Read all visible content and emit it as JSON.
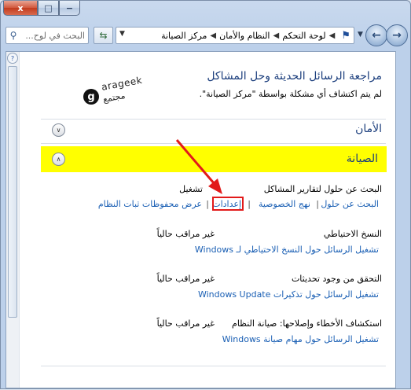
{
  "window": {
    "caption_close": "x",
    "caption_max": "□",
    "caption_min": "−"
  },
  "search": {
    "placeholder": "البحث في لوح..."
  },
  "address": {
    "crumbs": [
      "لوحة التحكم",
      "النظام والأمان",
      "مركز الصيانة"
    ]
  },
  "header": {
    "title": "مراجعة الرسائل الحديثة وحل المشاكل",
    "subtitle": "لم يتم اكتشاف أي مشكلة بواسطة \"مركز الصيانة\"."
  },
  "watermark": {
    "brand": "arageek",
    "tagline": "مجتمع"
  },
  "sections": {
    "security": {
      "title": "الأمان"
    },
    "maintenance": {
      "title": "الصيانة"
    }
  },
  "rows": {
    "problem_reports": {
      "label": "البحث عن حلول لتقارير المشاكل",
      "status": "تشغيل",
      "links": [
        "البحث عن حلول",
        "نهج الخصوصية",
        "إعدادات",
        "عرض محفوظات ثبات النظام"
      ]
    },
    "backup": {
      "label": "النسخ الاحتياطي",
      "status": "غير مراقب حالياً",
      "link": "تشغيل الرسائل حول النسخ الاحتياطي لـ Windows"
    },
    "updates": {
      "label": "التحقق من وجود تحديثات",
      "status": "غير مراقب حالياً",
      "link": "تشغيل الرسائل حول تذكيرات Windows Update"
    },
    "troubleshoot": {
      "label": "استكشاف الأخطاء وإصلاحها: صيانة النظام",
      "status": "غير مراقب حالياً",
      "link": "تشغيل الرسائل حول مهام صيانة Windows"
    }
  },
  "colors": {
    "highlight_band": "#ffff00",
    "annotation_red": "#e21a1a",
    "link": "#1a5fb4",
    "heading": "#1a3d7c"
  },
  "icons": {
    "search": "search-icon",
    "refresh": "refresh-icon",
    "flag": "flag-icon",
    "back": "back-arrow-icon",
    "forward": "forward-arrow-icon",
    "chevron": "chevron-icon",
    "help": "help-icon"
  }
}
